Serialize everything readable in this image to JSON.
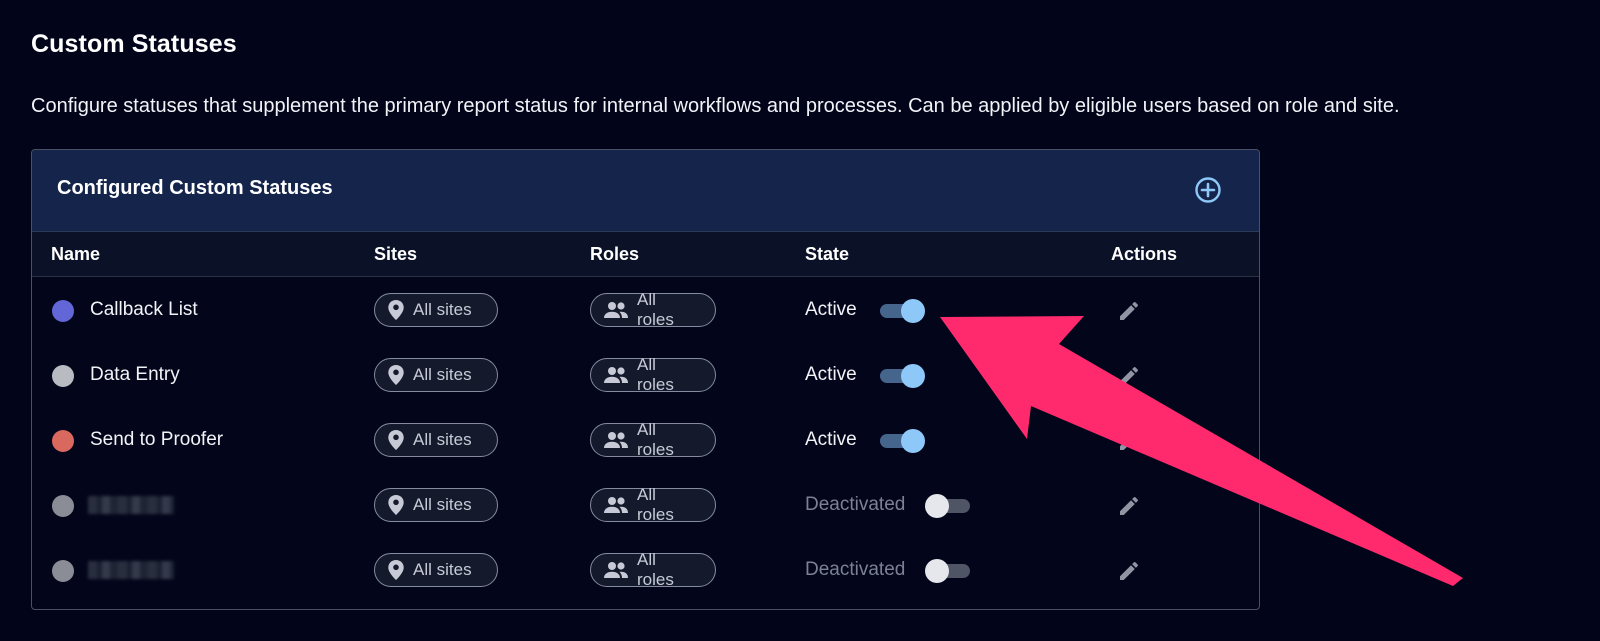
{
  "page": {
    "title": "Custom Statuses",
    "description": "Configure statuses that supplement the primary report status for internal workflows and processes. Can be applied by eligible users based on role and site."
  },
  "panel": {
    "title": "Configured Custom Statuses",
    "add_icon": "plus-circle-icon"
  },
  "columns": {
    "name": "Name",
    "sites": "Sites",
    "roles": "Roles",
    "state": "State",
    "actions": "Actions"
  },
  "rows": [
    {
      "name": "Callback List",
      "color": "#6366d6",
      "sites": "All sites",
      "roles": "All roles",
      "state": "Active",
      "active": true
    },
    {
      "name": "Data Entry",
      "color": "#b9bbc2",
      "sites": "All sites",
      "roles": "All roles",
      "state": "Active",
      "active": true
    },
    {
      "name": "Send to Proofer",
      "color": "#d9695e",
      "sites": "All sites",
      "roles": "All roles",
      "state": "Active",
      "active": true
    },
    {
      "name": "",
      "redacted": true,
      "color": "#8a8d96",
      "sites": "All sites",
      "roles": "All roles",
      "state": "Deactivated",
      "active": false
    },
    {
      "name": "",
      "redacted": true,
      "color": "#8a8d96",
      "sites": "All sites",
      "roles": "All roles",
      "state": "Deactivated",
      "active": false
    }
  ],
  "icons": {
    "sites": "map-pin-icon",
    "roles": "people-icon",
    "edit": "pencil-icon"
  },
  "annotation": {
    "arrow_color": "#ff2a6d"
  }
}
